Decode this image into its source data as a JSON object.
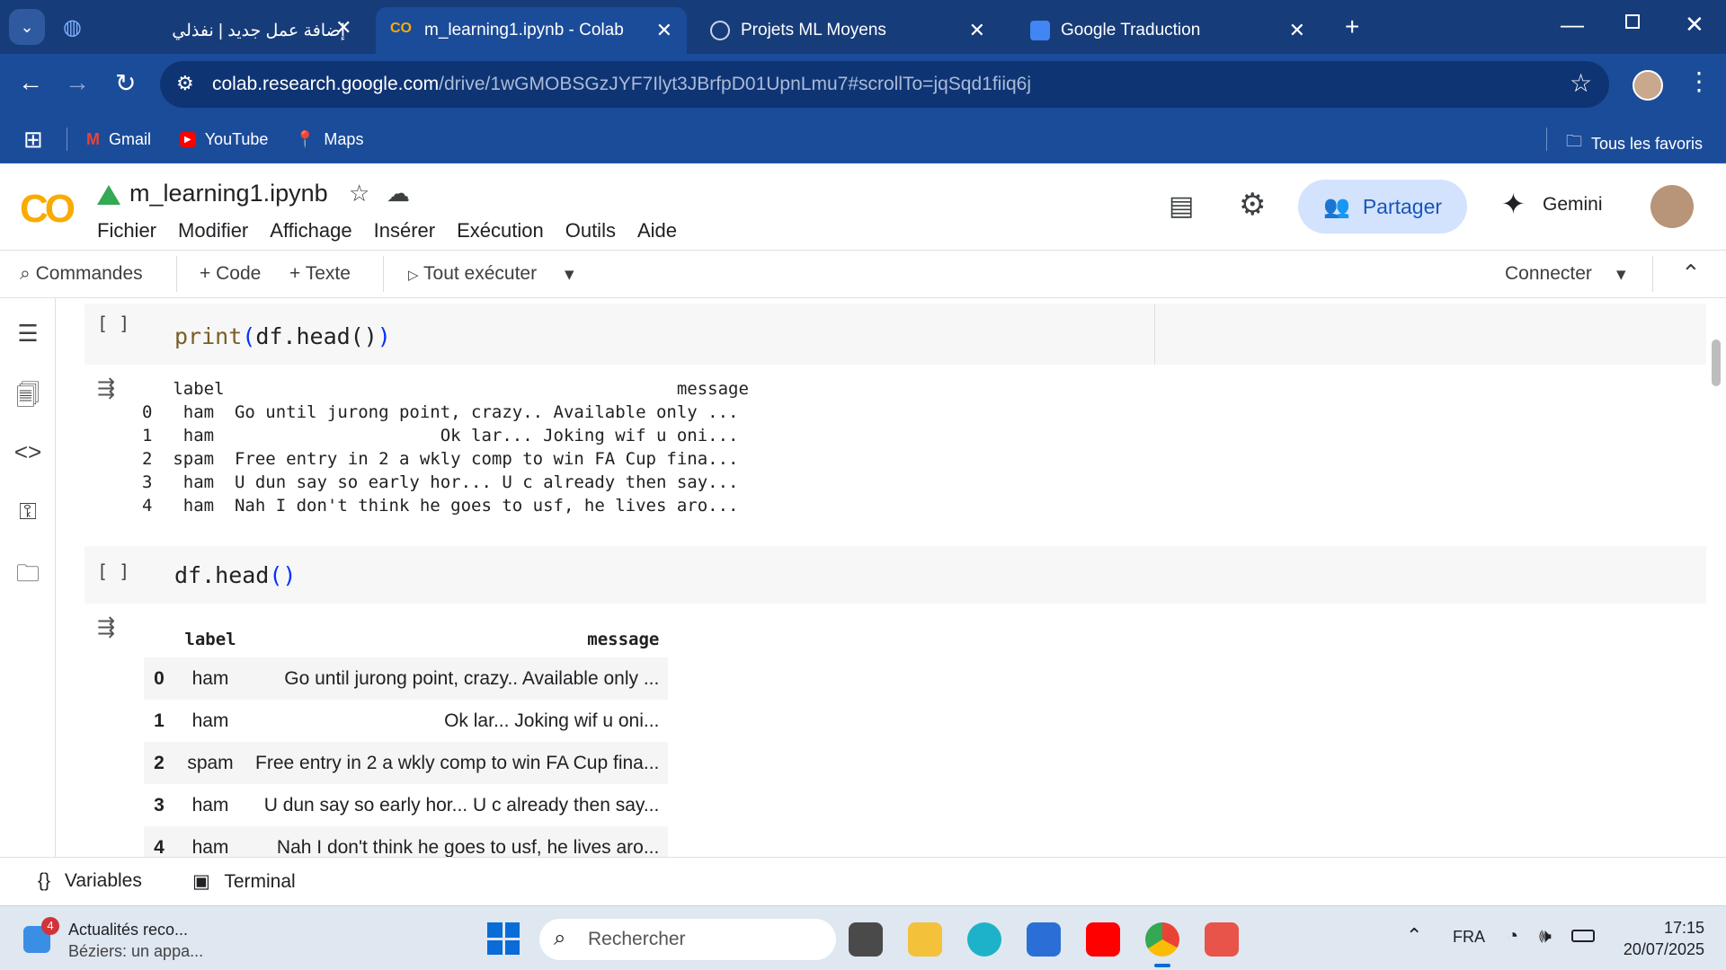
{
  "browser": {
    "tabs": [
      {
        "title": "إضافة عمل جديد | نفذلي",
        "active": false
      },
      {
        "title": "m_learning1.ipynb - Colab",
        "active": true
      },
      {
        "title": "Projets ML Moyens",
        "active": false
      },
      {
        "title": "Google Traduction",
        "active": false
      }
    ],
    "url_host": "colab.research.google.com",
    "url_path": "/drive/1wGMOBSGzJYF7Ilyt3JBrfpD01UpnLmu7#scrollTo=jqSqd1fiiq6j",
    "bookmarks": [
      "Gmail",
      "YouTube",
      "Maps"
    ],
    "all_bookmarks": "Tous les favoris"
  },
  "colab": {
    "logo": "CO",
    "notebook_name": "m_learning1.ipynb",
    "menus": [
      "Fichier",
      "Modifier",
      "Affichage",
      "Insérer",
      "Exécution",
      "Outils",
      "Aide"
    ],
    "share_label": "Partager",
    "gemini_label": "Gemini",
    "toolbar": {
      "commands": "Commandes",
      "add_code": "+ Code",
      "add_text": "+ Texte",
      "run_all": "Tout exécuter",
      "connect": "Connecter"
    },
    "cells": [
      {
        "run_indicator": "[ ]",
        "code_fn": "print",
        "code_arg": "df.head()",
        "output_text": "   label                                            message\n0   ham  Go until jurong point, crazy.. Available only ...\n1   ham                      Ok lar... Joking wif u oni...\n2  spam  Free entry in 2 a wkly comp to win FA Cup fina...\n3   ham  U dun say so early hor... U c already then say...\n4   ham  Nah I don't think he goes to usf, he lives aro..."
      },
      {
        "run_indicator": "[ ]",
        "code": "df.head",
        "code_call": "()",
        "table": {
          "columns": [
            "",
            "label",
            "message"
          ],
          "rows": [
            [
              "0",
              "ham",
              "Go until jurong point, crazy.. Available only ..."
            ],
            [
              "1",
              "ham",
              "Ok lar... Joking wif u oni..."
            ],
            [
              "2",
              "spam",
              "Free entry in 2 a wkly comp to win FA Cup fina..."
            ],
            [
              "3",
              "ham",
              "U dun say so early hor... U c already then say..."
            ],
            [
              "4",
              "ham",
              "Nah I don't think he goes to usf, he lives aro..."
            ]
          ]
        }
      }
    ],
    "bottom": {
      "variables": "Variables",
      "terminal": "Terminal"
    }
  },
  "taskbar": {
    "news_badge": "4",
    "news_title": "Actualités reco...",
    "news_sub": "Béziers: un appa...",
    "search_placeholder": "Rechercher",
    "language": "FRA",
    "time": "17:15",
    "date": "20/07/2025"
  },
  "colors": {
    "chrome_dark": "#173c7a",
    "chrome": "#1b4c9a",
    "share_bg": "#d3e3fd",
    "colab_orange": "#f9ab00"
  }
}
